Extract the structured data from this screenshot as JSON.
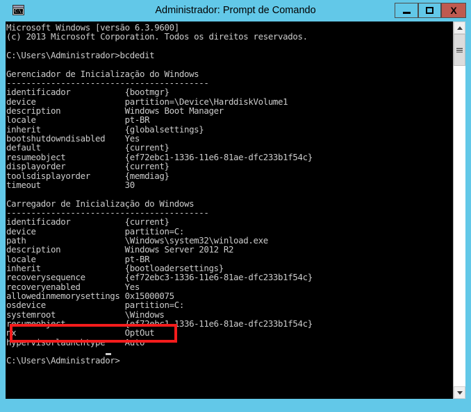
{
  "window": {
    "title": "Administrador: Prompt de Comando",
    "icon": "cmd-console-icon",
    "icon_text": "C:\\.",
    "titlebar_color": "#62c8e8",
    "close_button_color": "#bf5a50",
    "console_bg": "#000000",
    "console_fg": "#cccccc"
  },
  "window_controls": {
    "minimize_label": "–",
    "maximize_label": "□",
    "close_label": "X",
    "minimize_name": "Minimizar",
    "maximize_name": "Maximizar",
    "close_name": "Fechar"
  },
  "annotation": {
    "highlight_color": "#f41c1c",
    "highlighted_line": "hypervisorlaunchtype      Auto",
    "highlighted_key": "hypervisorlaunchtype",
    "highlighted_value": "Auto"
  },
  "scrollbar": {
    "up_arrow": "▲",
    "down_arrow": "▼",
    "thumb_position": "top"
  },
  "console": {
    "banner": [
      "Microsoft Windows [versão 6.3.9600]",
      "(c) 2013 Microsoft Corporation. Todos os direitos reservados."
    ],
    "command_prompt": "C:\\Users\\Administrador>",
    "command_entered": "bcdedit",
    "final_prompt": "C:\\Users\\Administrador>",
    "separator": "-----------------------------------------",
    "value_column": 24,
    "sections": [
      {
        "heading": "Gerenciador de Inicialização do Windows",
        "entries": [
          {
            "key": "identificador",
            "value": "{bootmgr}"
          },
          {
            "key": "device",
            "value": "partition=\\Device\\HarddiskVolume1"
          },
          {
            "key": "description",
            "value": "Windows Boot Manager"
          },
          {
            "key": "locale",
            "value": "pt-BR"
          },
          {
            "key": "inherit",
            "value": "{globalsettings}"
          },
          {
            "key": "bootshutdowndisabled",
            "value": "Yes"
          },
          {
            "key": "default",
            "value": "{current}"
          },
          {
            "key": "resumeobject",
            "value": "{ef72ebc1-1336-11e6-81ae-dfc233b1f54c}"
          },
          {
            "key": "displayorder",
            "value": "{current}"
          },
          {
            "key": "toolsdisplayorder",
            "value": "{memdiag}"
          },
          {
            "key": "timeout",
            "value": "30"
          }
        ]
      },
      {
        "heading": "Carregador de Inicialização do Windows",
        "entries": [
          {
            "key": "identificador",
            "value": "{current}"
          },
          {
            "key": "device",
            "value": "partition=C:"
          },
          {
            "key": "path",
            "value": "\\Windows\\system32\\winload.exe"
          },
          {
            "key": "description",
            "value": "Windows Server 2012 R2"
          },
          {
            "key": "locale",
            "value": "pt-BR"
          },
          {
            "key": "inherit",
            "value": "{bootloadersettings}"
          },
          {
            "key": "recoverysequence",
            "value": "{ef72ebc3-1336-11e6-81ae-dfc233b1f54c}"
          },
          {
            "key": "recoveryenabled",
            "value": "Yes"
          },
          {
            "key": "allowedinmemorysettings",
            "value": "0x15000075"
          },
          {
            "key": "osdevice",
            "value": "partition=C:"
          },
          {
            "key": "systemroot",
            "value": "\\Windows"
          },
          {
            "key": "resumeobject",
            "value": "{ef72ebc1-1336-11e6-81ae-dfc233b1f54c}"
          },
          {
            "key": "nx",
            "value": "OptOut"
          },
          {
            "key": "hypervisorlaunchtype",
            "value": "Auto"
          }
        ]
      }
    ]
  }
}
